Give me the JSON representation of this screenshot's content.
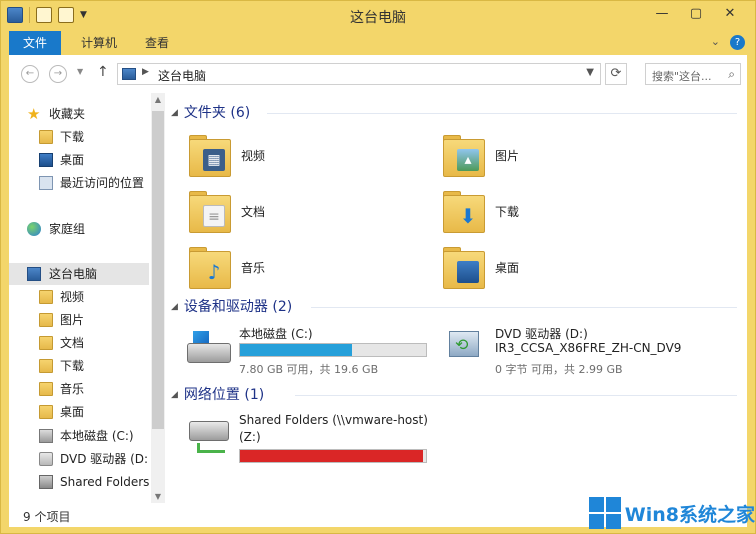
{
  "window": {
    "title": "这台电脑"
  },
  "window_buttons": {
    "minimize": "—",
    "maximize": "▢",
    "close": "✕"
  },
  "ribbon": {
    "tabs": [
      "文件",
      "计算机",
      "查看"
    ],
    "collapse": "⌄",
    "help": "?"
  },
  "address": {
    "path": "这台电脑",
    "search_placeholder": "搜索\"这台..."
  },
  "sidebar": {
    "items": [
      {
        "label": "收藏夹",
        "icon": "star-icon"
      },
      {
        "label": "下载",
        "icon": "folder-download-icon"
      },
      {
        "label": "桌面",
        "icon": "desktop-icon"
      },
      {
        "label": "最近访问的位置",
        "icon": "recent-places-icon"
      },
      {
        "label": "家庭组",
        "icon": "homegroup-icon"
      },
      {
        "label": "这台电脑",
        "icon": "computer-icon"
      },
      {
        "label": "视频",
        "icon": "folder-video-icon"
      },
      {
        "label": "图片",
        "icon": "folder-pictures-icon"
      },
      {
        "label": "文档",
        "icon": "folder-documents-icon"
      },
      {
        "label": "下载",
        "icon": "folder-download-icon"
      },
      {
        "label": "音乐",
        "icon": "folder-music-icon"
      },
      {
        "label": "桌面",
        "icon": "folder-desktop-icon"
      },
      {
        "label": "本地磁盘 (C:)",
        "icon": "local-disk-icon"
      },
      {
        "label": "DVD 驱动器 (D:)",
        "icon": "dvd-drive-icon"
      },
      {
        "label": "Shared Folders",
        "icon": "network-drive-icon"
      }
    ]
  },
  "groups": {
    "folders": {
      "header": "文件夹 (6)",
      "items": [
        {
          "label": "视频",
          "icon": "video-folder-icon"
        },
        {
          "label": "图片",
          "icon": "pictures-folder-icon"
        },
        {
          "label": "文档",
          "icon": "documents-folder-icon"
        },
        {
          "label": "下载",
          "icon": "downloads-folder-icon"
        },
        {
          "label": "音乐",
          "icon": "music-folder-icon"
        },
        {
          "label": "桌面",
          "icon": "desktop-folder-icon"
        }
      ]
    },
    "devices": {
      "header": "设备和驱动器 (2)",
      "local_disk": {
        "name": "本地磁盘 (C:)",
        "free_text": "7.80 GB 可用，共 19.6 GB",
        "used_fraction": 0.602
      },
      "dvd": {
        "name": "DVD 驱动器 (D:)",
        "label": "IR3_CCSA_X86FRE_ZH-CN_DV9",
        "free_text": "0 字节 可用，共 2.99 GB"
      }
    },
    "network": {
      "header": "网络位置 (1)",
      "share": {
        "name": "Shared Folders (\\\\vmware-host)",
        "drive": "(Z:)",
        "used_fraction": 0.985
      }
    }
  },
  "status": {
    "count": "9 个项目"
  },
  "watermark": {
    "text": "Win8系统之家"
  },
  "colors": {
    "accent": "#1979ca",
    "bar_normal": "#26a0da",
    "bar_full": "#da2626",
    "group_header": "#1e3287"
  }
}
